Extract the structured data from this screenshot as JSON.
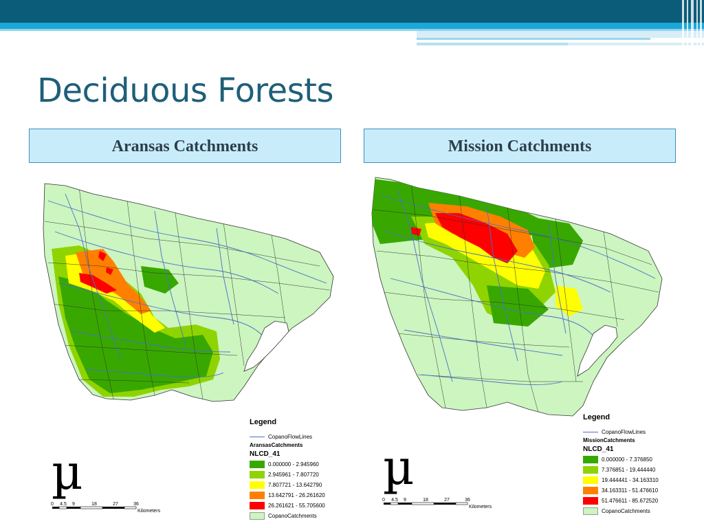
{
  "slide": {
    "title": "Deciduous Forests"
  },
  "colors": {
    "title": "#1f5f78",
    "header_band": "#0b5c79",
    "accent_band": "#1ba7d8",
    "panel_fill": "#c9ecfb",
    "panel_border": "#3a8fbd",
    "flow_lines": "#4a6fc7"
  },
  "panels": [
    {
      "header": "Aransas Catchments",
      "legend": {
        "title": "Legend",
        "flowlines_label": "CopanoFlowLines",
        "layer_name": "AransasCatchments",
        "field_name": "NLCD_41",
        "classes": [
          {
            "range": "0.000000 - 2.945960",
            "color": "#38a800"
          },
          {
            "range": "2.945961 - 7.807720",
            "color": "#8fd400"
          },
          {
            "range": "7.807721 - 13.642790",
            "color": "#ffff00"
          },
          {
            "range": "13.642791 - 26.261620",
            "color": "#ff8000"
          },
          {
            "range": "26.261621 - 55.705600",
            "color": "#ff0000"
          }
        ],
        "base_layer": {
          "label": "CopanoCatchments",
          "color": "#ccf5c0"
        }
      },
      "north_arrow": "µ",
      "scale_bar": {
        "ticks": [
          "0",
          "4.5",
          "9",
          "18",
          "27",
          "36"
        ],
        "unit": "Kilometers"
      }
    },
    {
      "header": "Mission Catchments",
      "legend": {
        "title": "Legend",
        "flowlines_label": "CopanoFlowLines",
        "layer_name": "MissionCatchments",
        "field_name": "NLCD_41",
        "classes": [
          {
            "range": "0.000000 - 7.376850",
            "color": "#38a800"
          },
          {
            "range": "7.376851 - 19.444440",
            "color": "#8fd400"
          },
          {
            "range": "19.444441 - 34.163310",
            "color": "#ffff00"
          },
          {
            "range": "34.163311 - 51.476610",
            "color": "#ff8000"
          },
          {
            "range": "51.476611 - 85.672520",
            "color": "#ff0000"
          }
        ],
        "base_layer": {
          "label": "CopanoCatchments",
          "color": "#ccf5c0"
        }
      },
      "north_arrow": "µ",
      "scale_bar": {
        "ticks": [
          "0",
          "4.5",
          "9",
          "18",
          "27",
          "36"
        ],
        "unit": "Kilometers"
      }
    }
  ]
}
